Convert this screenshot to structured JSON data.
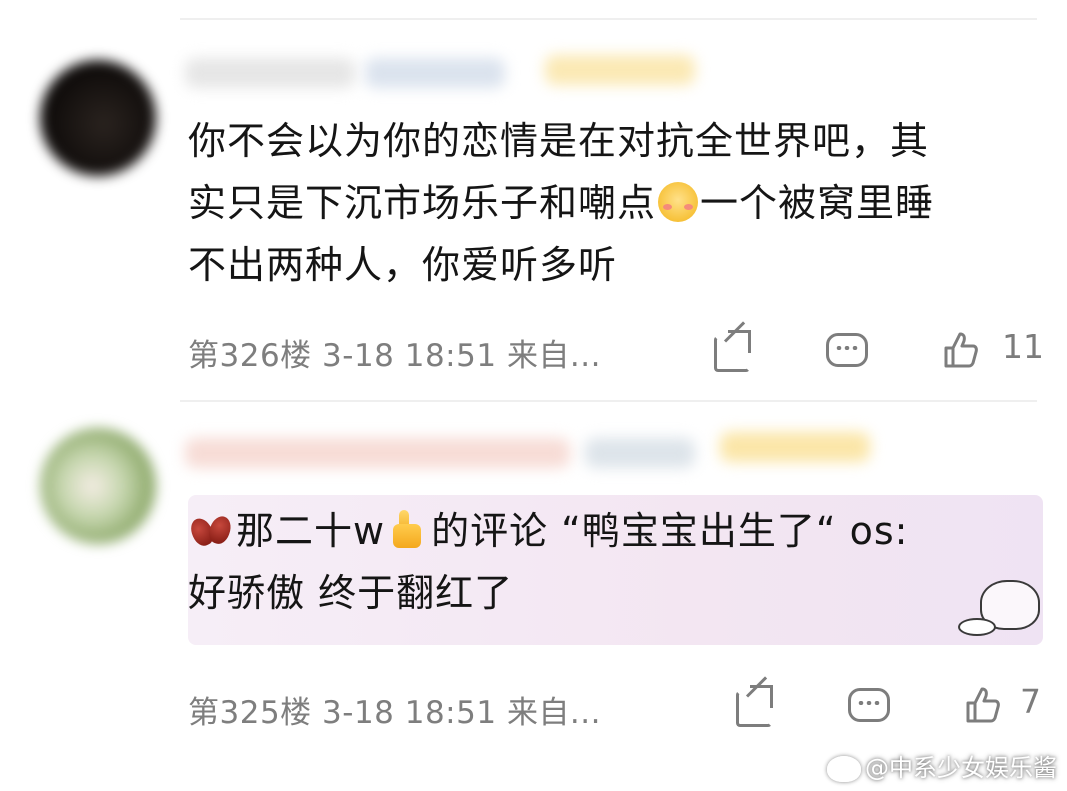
{
  "comments": [
    {
      "body_lines": [
        "你不会以为你的恋情是在对抗全世界吧，其",
        "实只是下沉市场乐子和嘲点",
        "一个被窝里睡",
        "不出两种人，你爱听多听"
      ],
      "floor": "第326楼",
      "time": "3-18 18:51",
      "source": "来自...",
      "like_count": "11"
    },
    {
      "body_lines": [
        "那二十w",
        "的评论 “鸭宝宝出生了“ os:",
        "好骄傲 终于翻红了"
      ],
      "floor": "第325楼",
      "time": "3-18 18:51",
      "source": "来自...",
      "like_count": "7"
    }
  ],
  "watermark": "@中系少女娱乐酱",
  "icons": {
    "share": "share-icon",
    "comment": "comment-icon",
    "like": "thumbs-up-icon",
    "blush_emoji": "blushing-smile-emoji",
    "beans_emoji": "red-bean-emoji",
    "thumb_emoji": "thumbs-up-emoji",
    "watermark_logo": "weibo-logo-icon"
  },
  "colors": {
    "text": "#151515",
    "meta_text": "#7e7e7e",
    "highlight_bg": "#f3e6f2"
  }
}
